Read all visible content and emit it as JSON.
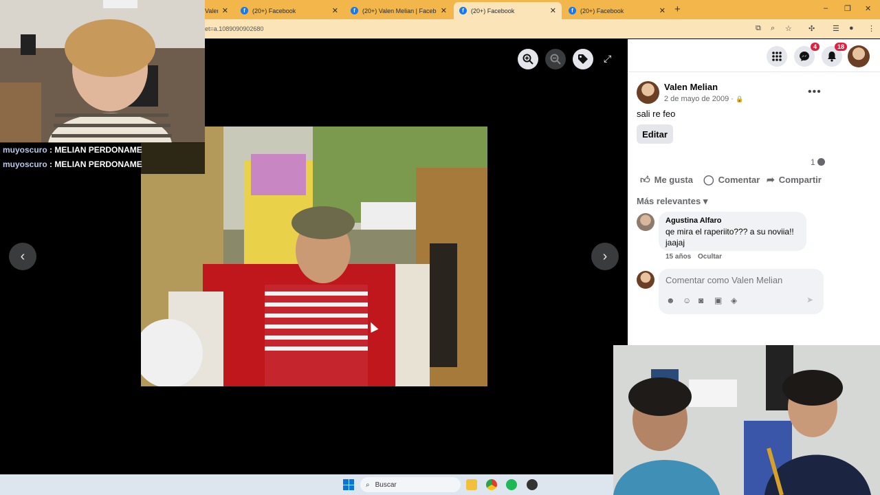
{
  "browser": {
    "tabs": [
      {
        "label": "Valen/",
        "active": false
      },
      {
        "label": "(20+) Facebook",
        "active": false
      },
      {
        "label": "(20+) Valen Melian | Facebook",
        "active": false
      },
      {
        "label": "(20+) Facebook",
        "active": true
      },
      {
        "label": "(20+) Facebook",
        "active": false
      }
    ],
    "url": "et=a.1089090902680",
    "new_tab": "+",
    "window_controls": [
      "–",
      "❐",
      "✕"
    ],
    "colors": {
      "tab_bar": "#f3b64a",
      "active_tab": "#fbe4b8"
    }
  },
  "viewer": {
    "zoom_in_icon": "zoom-in-icon",
    "zoom_out_icon": "zoom-out-icon",
    "tag_icon": "tag-icon",
    "fullscreen_icon": "expand-icon",
    "prev": "‹",
    "next": "›"
  },
  "facebook": {
    "header": {
      "menu_icon": "grid-menu-icon",
      "messenger_badge": "4",
      "notifications_badge": "18"
    },
    "post": {
      "author": "Valen Melian",
      "date": "2 de mayo de 2009 ·",
      "privacy_icon": "🔒",
      "more": "•••",
      "text": "sali re feo",
      "edit_label": "Editar",
      "comment_count": "1"
    },
    "actions": {
      "like": "Me gusta",
      "comment": "Comentar",
      "share": "Compartir"
    },
    "sort_label": "Más relevantes ▾",
    "comment": {
      "author": "Agustina Alfaro",
      "text_line1": "qe mira el raperiito??? a su noviia!!",
      "text_line2": "jaajaj",
      "age": "15 años",
      "hide": "Ocultar"
    },
    "composer": {
      "placeholder": "Comentar como Valen Melian"
    }
  },
  "stream_chat": [
    {
      "user": "muyoscuro",
      "message": ": MELIAN PERDONAME"
    },
    {
      "user": "muyoscuro",
      "message": ": MELIAN PERDONAME"
    }
  ],
  "taskbar": {
    "search_placeholder": "Buscar"
  }
}
